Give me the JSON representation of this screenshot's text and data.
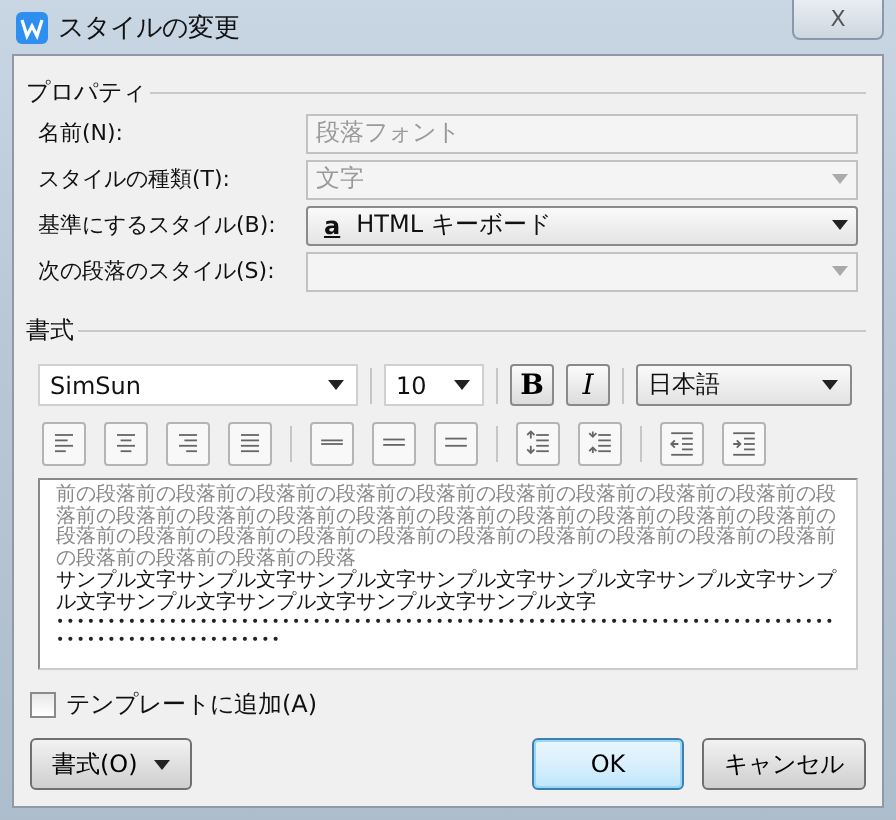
{
  "window": {
    "title": "スタイルの変更",
    "close": "X"
  },
  "properties": {
    "legend": "プロパティ",
    "rows": [
      {
        "label": "名前(N):",
        "kind": "text",
        "value": "段落フォント",
        "disabled": true
      },
      {
        "label": "スタイルの種類(T):",
        "kind": "dropdown",
        "value": "文字",
        "disabled": true
      },
      {
        "label": "基準にするスタイル(B):",
        "kind": "dropdown",
        "value": "HTML キーボード",
        "icon": "a",
        "disabled": false
      },
      {
        "label": "次の段落のスタイル(S):",
        "kind": "dropdown",
        "disabled": true
      }
    ]
  },
  "format": {
    "legend": "書式",
    "font": "SimSun",
    "size": "10",
    "bold": "B",
    "italic": "I",
    "language": "日本語",
    "tools": [
      {
        "kind": "align-left"
      },
      {
        "kind": "align-center"
      },
      {
        "kind": "align-right"
      },
      {
        "kind": "justify"
      },
      {
        "kind": "spacing-single"
      },
      {
        "kind": "spacing-onehalf"
      },
      {
        "kind": "spacing-double"
      },
      {
        "kind": "space-up"
      },
      {
        "kind": "space-down"
      },
      {
        "kind": "indent-less"
      },
      {
        "kind": "indent-more"
      }
    ],
    "preview": {
      "previous": "前の段落前の段落前の段落前の段落前の段落前の段落前の段落前の段落前の段落前の段落前の段落前の段落前の段落前の段落前の段落前の段落前の段落前の段落前の段落前の段落前の段落前の段落前の段落前の段落前の段落前の段落前の段落前の段落前の段落前の段落前の段落前の段落前の段落",
      "sample": "サンプル文字サンプル文字サンプル文字サンプル文字サンプル文字サンプル文字サンプル文字サンプル文字サンプル文字サンプル文字サンプル文字",
      "next": "••••••••••••••••••••••••••••••••••••••••••••••••••••••••••••••••••••••••••••••••••••••••••••••••••"
    }
  },
  "template": {
    "label": "テンプレートに追加(A)",
    "checked": false
  },
  "buttons": [
    {
      "label": "書式(O)",
      "kind": "menu",
      "default": false
    },
    {
      "label": "OK",
      "kind": "plain",
      "default": true
    },
    {
      "label": "キャンセル",
      "kind": "plain",
      "default": false
    }
  ]
}
